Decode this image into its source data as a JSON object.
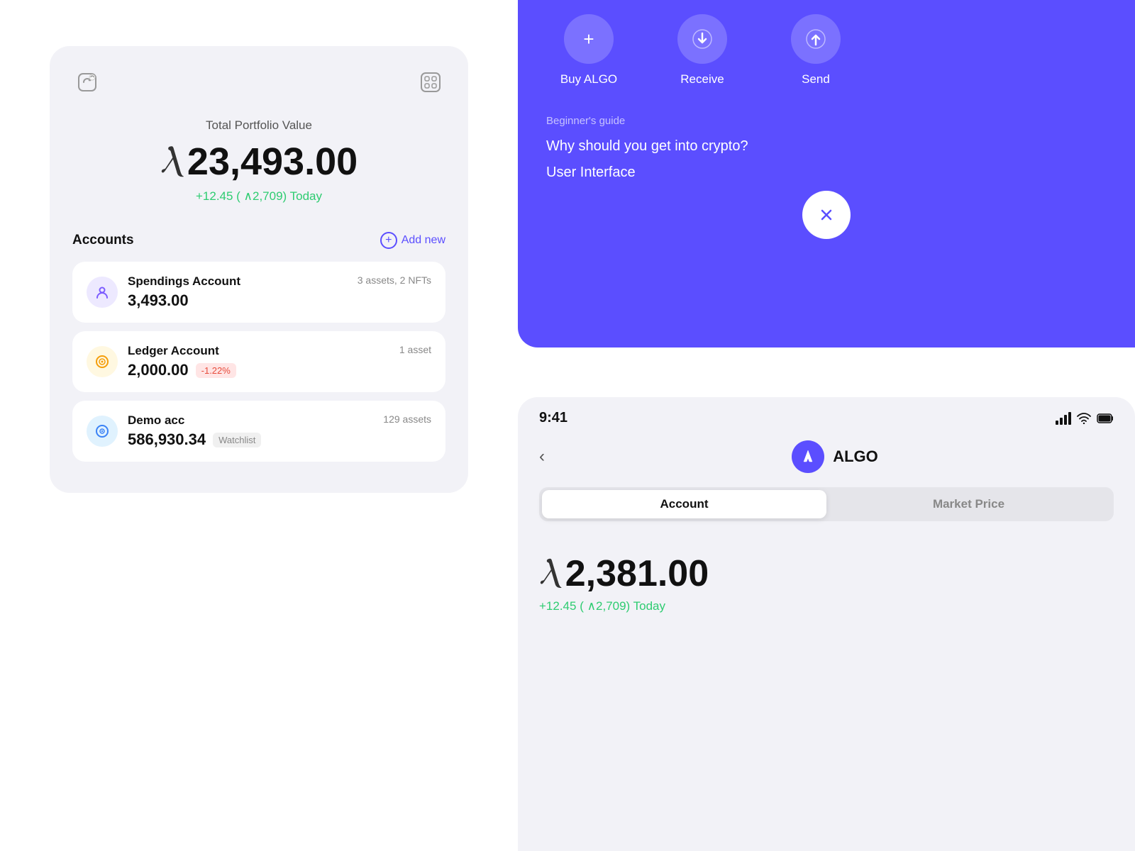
{
  "leftPanel": {
    "portfolioLabel": "Total Portfolio Value",
    "portfolioValue": "23,493.00",
    "portfolioChange": "+12.45 ( ∧2,709) Today",
    "accountsTitle": "Accounts",
    "addNewLabel": "Add new",
    "accounts": [
      {
        "name": "Spendings Account",
        "assets": "3 assets, 2 NFTs",
        "balance": "3,493.00",
        "badge": null,
        "iconType": "purple",
        "iconSymbol": "⊕"
      },
      {
        "name": "Ledger Account",
        "assets": "1 asset",
        "balance": "2,000.00",
        "badge": "-1.22%",
        "badgeType": "negative",
        "iconType": "yellow",
        "iconSymbol": "⊕"
      },
      {
        "name": "Demo acc",
        "assets": "129 assets",
        "balance": "586,930.34",
        "badge": "Watchlist",
        "badgeType": "watchlist",
        "iconType": "blue",
        "iconSymbol": "◎"
      }
    ]
  },
  "rightTop": {
    "actions": [
      {
        "label": "Buy ALGO",
        "icon": "+"
      },
      {
        "label": "Receive",
        "icon": "↓"
      },
      {
        "label": "Send",
        "icon": "↑"
      }
    ],
    "beginnerGuide": {
      "label": "Beginner's guide",
      "items": [
        "Why should you get into crypto?",
        "User Interface"
      ]
    },
    "closeIcon": "×"
  },
  "rightBottom": {
    "statusTime": "9:41",
    "backLabel": "‹",
    "algoName": "ALGO",
    "tabs": [
      {
        "label": "Account",
        "active": true
      },
      {
        "label": "Market Price",
        "active": false
      }
    ],
    "balanceValue": "2,381.00",
    "balanceChange": "+12.45 ( ∧2,709) Today"
  }
}
